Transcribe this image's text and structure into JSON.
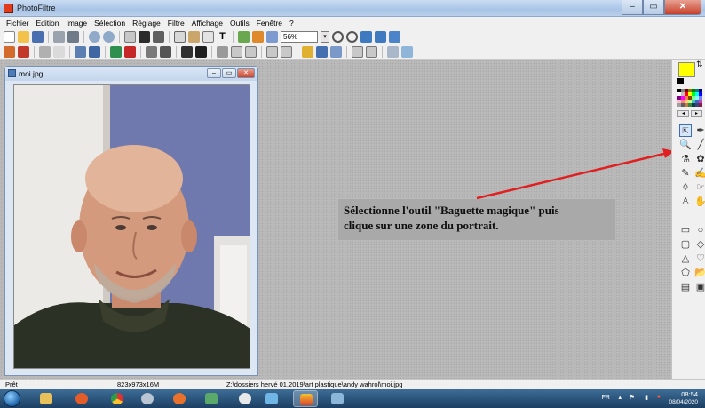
{
  "app": {
    "title": "PhotoFiltre"
  },
  "menu": [
    "Fichier",
    "Edition",
    "Image",
    "Sélection",
    "Réglage",
    "Filtre",
    "Affichage",
    "Outils",
    "Fenêtre",
    "?"
  ],
  "toolbar": {
    "zoom_value": "56%"
  },
  "document": {
    "title": "moi.jpg"
  },
  "annotation": {
    "line1": "Sélectionne l'outil \"Baguette magique\" puis",
    "line2": "clique sur une zone du portrait."
  },
  "colors": {
    "foreground": "#ffff00",
    "background": "#000000",
    "arrow": "#e02020"
  },
  "statusbar": {
    "state": "Prêt",
    "dimensions": "823x973x16M",
    "path": "Z:\\dossiers hervé 01.2019\\art plastique\\andy wahrol\\moi.jpg"
  },
  "tray": {
    "language": "FR",
    "time": "08:54",
    "date": "08/04/2020"
  },
  "icons": [
    "search-icon",
    "magic-wand-icon",
    "pen-icon",
    "brush-icon",
    "hand-icon"
  ]
}
